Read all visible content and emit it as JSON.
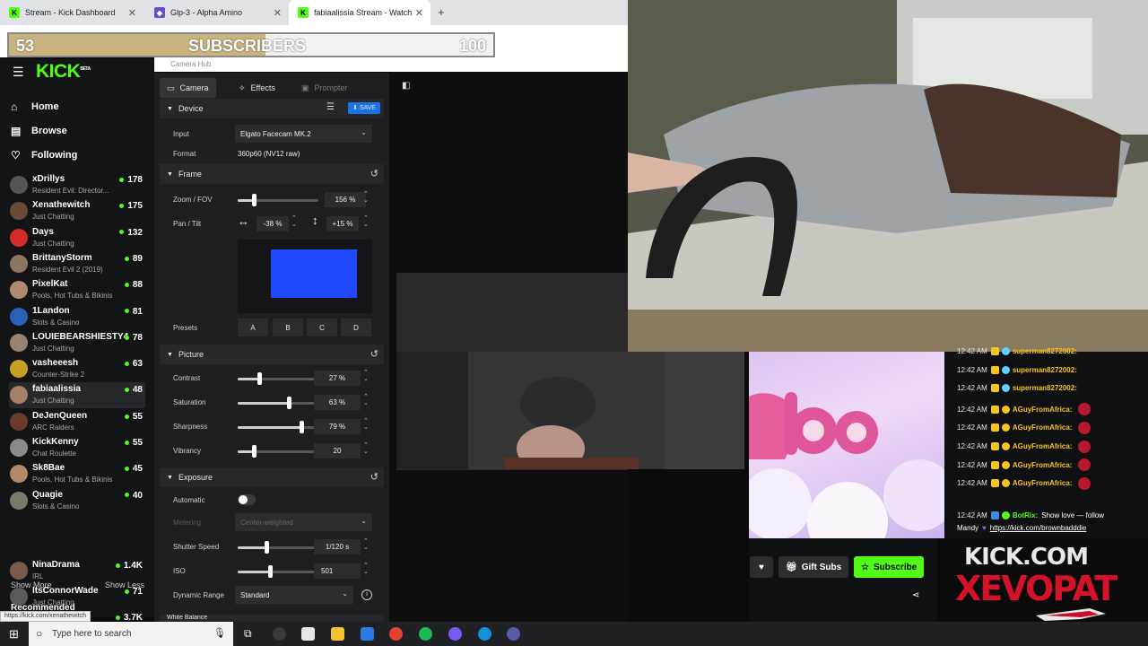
{
  "browser": {
    "tabs": [
      {
        "title": "Stream - Kick Dashboard",
        "active": false
      },
      {
        "title": "Glp-3 - Alpha Amino",
        "active": false
      },
      {
        "title": "fabiaalissia Stream - Watch Live",
        "active": true
      }
    ],
    "status_url": "https://kick.com/xenathewitch"
  },
  "goal": {
    "current": "53",
    "label": "SUBSCRIBERS",
    "target": "100",
    "progress": 0.53
  },
  "kick": {
    "logo": "KICK",
    "logo_badge": "BETA",
    "nav": [
      {
        "label": "Home",
        "icon": "home-icon"
      },
      {
        "label": "Browse",
        "icon": "browse-icon"
      },
      {
        "label": "Following",
        "icon": "heart-icon"
      }
    ],
    "channels": [
      {
        "name": "xDrillys",
        "category": "Resident Evil: Director...",
        "viewers": "178",
        "color": "#555"
      },
      {
        "name": "Xenathewitch",
        "category": "Just Chatting",
        "viewers": "175",
        "color": "#6b4a3a"
      },
      {
        "name": "Days",
        "category": "Just Chatting",
        "viewers": "132",
        "color": "#d62b2b"
      },
      {
        "name": "BrittanyStorm",
        "category": "Resident Evil 2 (2019)",
        "viewers": "89",
        "color": "#8a7560"
      },
      {
        "name": "PixelKat",
        "category": "Pools, Hot Tubs & Bikinis",
        "viewers": "88",
        "color": "#b08a70"
      },
      {
        "name": "1Landon",
        "category": "Slots & Casino",
        "viewers": "81",
        "color": "#2a5fb8"
      },
      {
        "name": "LOUIEBEARSHIESTY4",
        "category": "Just Chatting",
        "viewers": "78",
        "color": "#9a8270"
      },
      {
        "name": "vasheeesh",
        "category": "Counter-Strike 2",
        "viewers": "63",
        "color": "#c8a020"
      },
      {
        "name": "fabiaalissia",
        "category": "Just Chatting",
        "viewers": "48",
        "color": "#a88068"
      },
      {
        "name": "DeJenQueen",
        "category": "ARC Raiders",
        "viewers": "55",
        "color": "#6a3a2a"
      },
      {
        "name": "KickKenny",
        "category": "Chat Roulette",
        "viewers": "55",
        "color": "#8a8a8a"
      },
      {
        "name": "Sk8Bae",
        "category": "Pools, Hot Tubs & Bikinis",
        "viewers": "45",
        "color": "#b48a6a"
      },
      {
        "name": "Quagie",
        "category": "Slots & Casino",
        "viewers": "40",
        "color": "#7a7a6a"
      }
    ],
    "show_more": "Show More",
    "show_less": "Show Less",
    "recommended_title": "Recommended",
    "recommended": [
      {
        "name": "NinaDrama",
        "category": "IRL",
        "viewers": "1.4K",
        "color": "#7a5a4a"
      },
      {
        "name": "ItsConnorWade",
        "category": "Just Chatting",
        "viewers": "71",
        "color": "#5a5a5a"
      },
      {
        "name": "",
        "category": "",
        "viewers": "3.7K",
        "color": "#444"
      }
    ]
  },
  "camhub": {
    "title": "Camera Hub",
    "tabs": [
      "Camera",
      "Effects",
      "Prompter"
    ],
    "device": {
      "section": "Device",
      "save": "SAVE",
      "input_label": "Input",
      "input_value": "Elgato Facecam MK.2",
      "format_label": "Format",
      "format_value": "360p60 (NV12 raw)"
    },
    "frame": {
      "section": "Frame",
      "zoom_label": "Zoom / FOV",
      "zoom_value": "156 %",
      "zoom_level": 0.2,
      "pantilt_label": "Pan / Tilt",
      "pan_value": "-38 %",
      "tilt_value": "+15 %",
      "presets_label": "Presets",
      "presets": [
        "A",
        "B",
        "C",
        "D"
      ],
      "preview_color": "#1f48ff"
    },
    "picture": {
      "section": "Picture",
      "rows": [
        {
          "label": "Contrast",
          "value": "27 %",
          "level": 0.27
        },
        {
          "label": "Saturation",
          "value": "63 %",
          "level": 0.63
        },
        {
          "label": "Sharpness",
          "value": "79 %",
          "level": 0.79
        },
        {
          "label": "Vibrancy",
          "value": "20",
          "level": 0.2
        }
      ]
    },
    "exposure": {
      "section": "Exposure",
      "automatic_label": "Automatic",
      "metering_label": "Metering",
      "metering_value": "Center-weighted",
      "shutter_label": "Shutter Speed",
      "shutter_value": "1/120 s",
      "shutter_level": 0.36,
      "iso_label": "ISO",
      "iso_value": "501",
      "iso_level": 0.4,
      "dr_label": "Dynamic Range",
      "dr_value": "Standard"
    },
    "next_section": "White Balance"
  },
  "chat": {
    "messages": [
      {
        "time": "12:42 AM",
        "user": "superman8272002:",
        "badge": "#5bd1ff"
      },
      {
        "time": "12:42 AM",
        "user": "superman8272002:",
        "badge": "#5bd1ff"
      },
      {
        "time": "12:42 AM",
        "user": "superman8272002:",
        "badge": "#5bd1ff"
      },
      {
        "time": "12:42 AM",
        "user": "AGuyFromAfrica:",
        "badge": "#f8c51c"
      },
      {
        "time": "12:42 AM",
        "user": "AGuyFromAfrica:",
        "badge": "#f8c51c"
      },
      {
        "time": "12:42 AM",
        "user": "AGuyFromAfrica:",
        "badge": "#f8c51c"
      },
      {
        "time": "12:42 AM",
        "user": "AGuyFromAfrica:",
        "badge": "#f8c51c"
      },
      {
        "time": "12:42 AM",
        "user": "AGuyFromAfrica:",
        "badge": "#f8c51c"
      }
    ],
    "bot_time": "12:42 AM",
    "bot_user": "BotRix:",
    "bot_text": "Show love — follow",
    "bot_text2": "Mandy",
    "bot_link": "https://kick.com/brownbadddie"
  },
  "actions": {
    "gift": "Gift Subs",
    "subscribe": "Subscribe"
  },
  "overlay": {
    "line1": "KICK.COM",
    "line2": "XEVOPAT"
  },
  "taskbar": {
    "search_placeholder": "Type here to search"
  },
  "colors": {
    "kick_green": "#53fc18",
    "save_blue": "#1a73e8",
    "goal_gold": "#c9b37e"
  }
}
